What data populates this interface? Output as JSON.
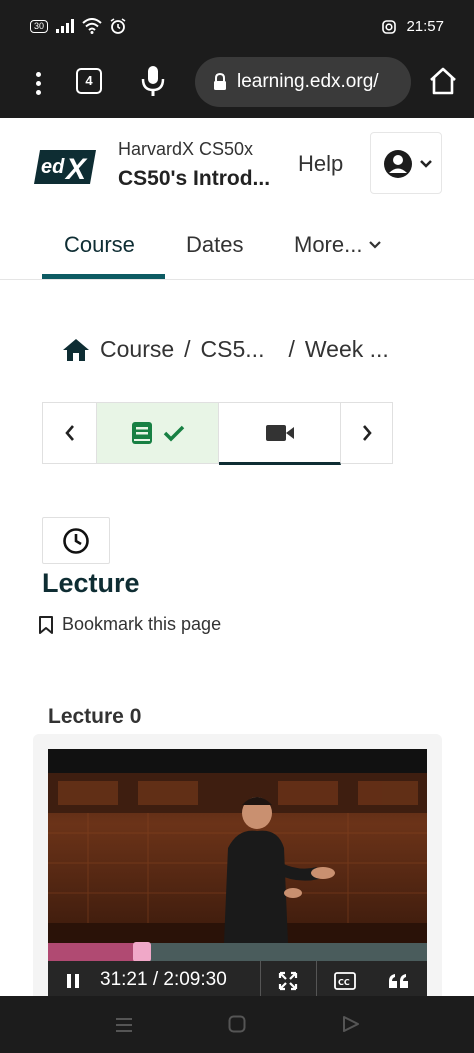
{
  "status_bar": {
    "network_badge": "30",
    "time": "21:57"
  },
  "browser": {
    "tab_count": "4",
    "url": "learning.edx.org/"
  },
  "header": {
    "logo_text": "edX",
    "org": "HarvardX CS50x",
    "title": "CS50's Introd...",
    "help": "Help"
  },
  "tabs": [
    {
      "label": "Course",
      "active": true
    },
    {
      "label": "Dates"
    },
    {
      "label": "More..."
    }
  ],
  "breadcrumb": {
    "home": "Course",
    "sep1": "/",
    "item1": "CS5...",
    "sep2": "/",
    "item2": "Week ..."
  },
  "unit": {
    "title": "Lecture",
    "bookmark": "Bookmark this page",
    "video_heading": "Lecture 0"
  },
  "video": {
    "time": "31:21 / 2:09:30",
    "progress": 0.2415
  },
  "colors": {
    "accent": "#0d5b63",
    "completed_bg": "#e8f5e6",
    "completed_icon": "#178043",
    "progress": "#b04a72"
  }
}
